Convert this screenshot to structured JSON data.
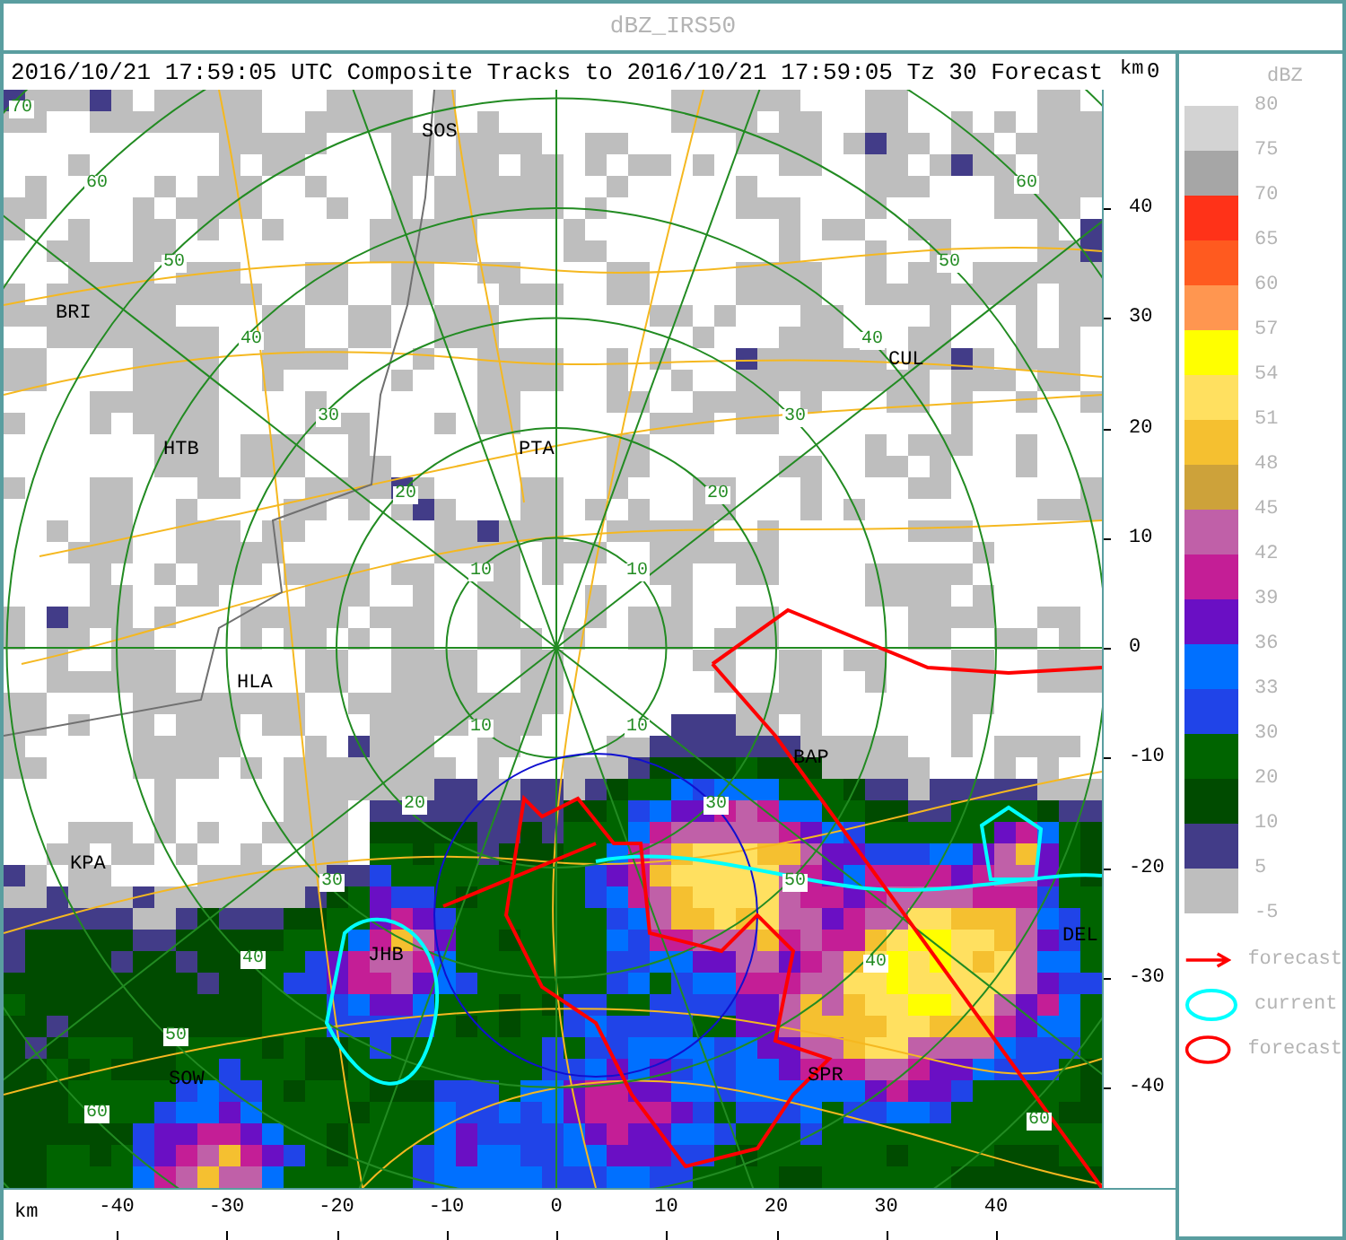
{
  "window": {
    "title": "dBZ_IRS50"
  },
  "header": "2016/10/21 17:59:05 UTC Composite Tracks to 2016/10/21 17:59:05 Tz 30 Forecast",
  "map": {
    "places": [
      "SOS",
      "BRI",
      "HTB",
      "PTA",
      "CUL",
      "HLA",
      "BAP",
      "KPA",
      "JHB",
      "SOW",
      "SPR",
      "DEL"
    ],
    "range_labels": [
      "70",
      "60",
      "50",
      "40",
      "30",
      "20",
      "10",
      "60",
      "50",
      "40",
      "30",
      "20",
      "10",
      "10",
      "20",
      "30",
      "40",
      "50",
      "60",
      "10",
      "30",
      "50",
      "40",
      "60"
    ]
  },
  "y_axis": {
    "unit": "km",
    "partial_tick": "0",
    "ticks": [
      "40",
      "30",
      "20",
      "10",
      "0",
      "-10",
      "-20",
      "-30",
      "-40"
    ]
  },
  "x_axis": {
    "unit": "km",
    "ticks": [
      "-40",
      "-30",
      "-20",
      "-10",
      "0",
      "10",
      "20",
      "30",
      "40"
    ]
  },
  "legend": {
    "title": "dBZ",
    "end_label": "-5",
    "scale": [
      {
        "label": "80",
        "color": "#d3d3d3"
      },
      {
        "label": "75",
        "color": "#a6a6a6"
      },
      {
        "label": "70",
        "color": "#ff3218"
      },
      {
        "label": "65",
        "color": "#ff5a1f"
      },
      {
        "label": "60",
        "color": "#ff9650"
      },
      {
        "label": "57",
        "color": "#ffff00"
      },
      {
        "label": "54",
        "color": "#ffe060"
      },
      {
        "label": "51",
        "color": "#f5c030"
      },
      {
        "label": "48",
        "color": "#cda23a"
      },
      {
        "label": "45",
        "color": "#c060a8"
      },
      {
        "label": "42",
        "color": "#c41e96"
      },
      {
        "label": "39",
        "color": "#6a0fc4"
      },
      {
        "label": "36",
        "color": "#0070ff"
      },
      {
        "label": "33",
        "color": "#2044e8"
      },
      {
        "label": "30",
        "color": "#006400"
      },
      {
        "label": "20",
        "color": "#004b00"
      },
      {
        "label": "10",
        "color": "#423c88"
      },
      {
        "label": "5",
        "color": "#bebebe"
      }
    ],
    "symbols": [
      {
        "kind": "arrow",
        "label": "forecast",
        "color": "#ff0000"
      },
      {
        "kind": "outline",
        "label": "current",
        "color": "#00ffff"
      },
      {
        "kind": "outline",
        "label": "forecast",
        "color": "#ff0000"
      }
    ]
  }
}
